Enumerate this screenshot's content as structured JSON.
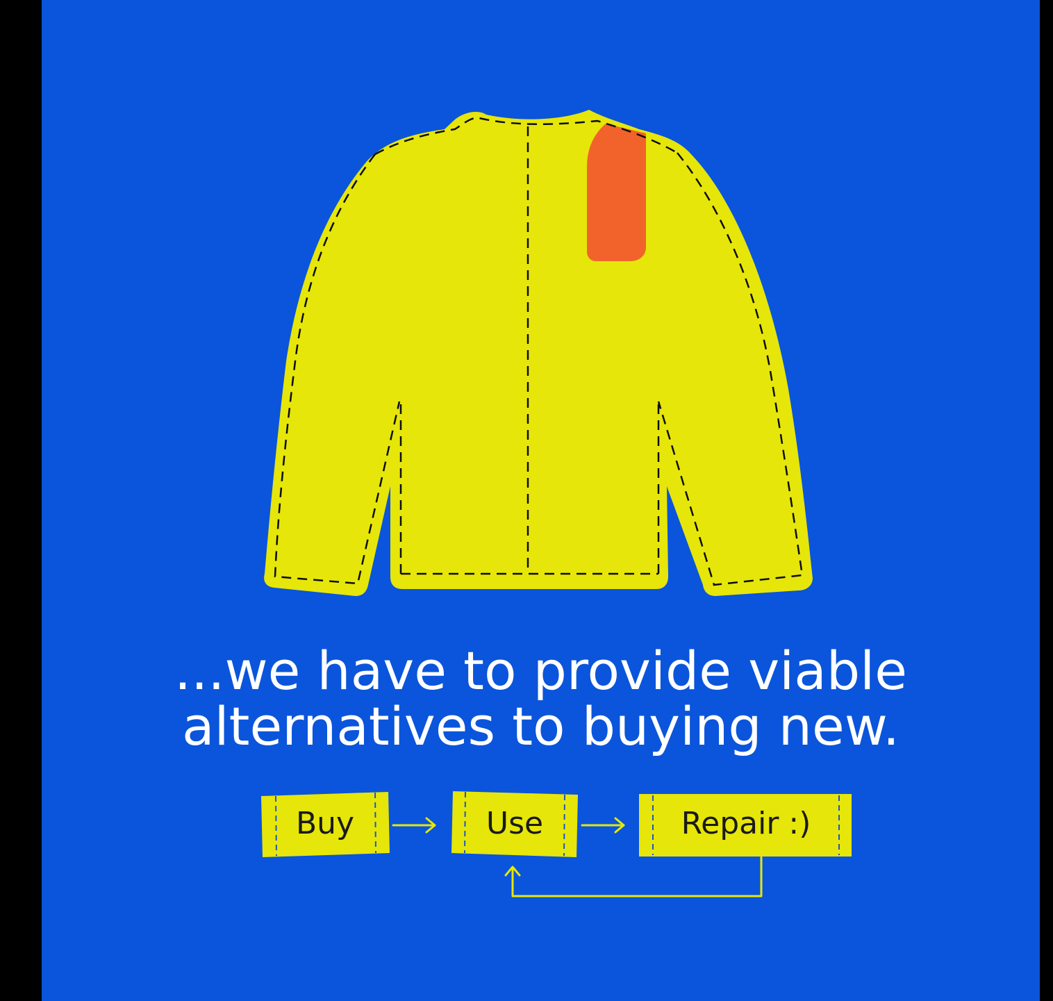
{
  "colors": {
    "background": "#0a55db",
    "border": "#000000",
    "garment": "#e6e60a",
    "patch": "#f2632b",
    "stitch": "#0d0d0d",
    "headline_text": "#ffffff",
    "label_text": "#1a1a1a",
    "arrow": "#e6e60a"
  },
  "illustration": {
    "icon": "sweater-with-patch-icon"
  },
  "headline": {
    "line1": "...we have to provide viable",
    "line2": "alternatives to buying new."
  },
  "flow": {
    "steps": [
      "Buy",
      "Use",
      "Repair :)"
    ],
    "connectors": [
      "right-arrow-icon",
      "right-arrow-icon",
      "loop-back-arrow-icon"
    ]
  }
}
